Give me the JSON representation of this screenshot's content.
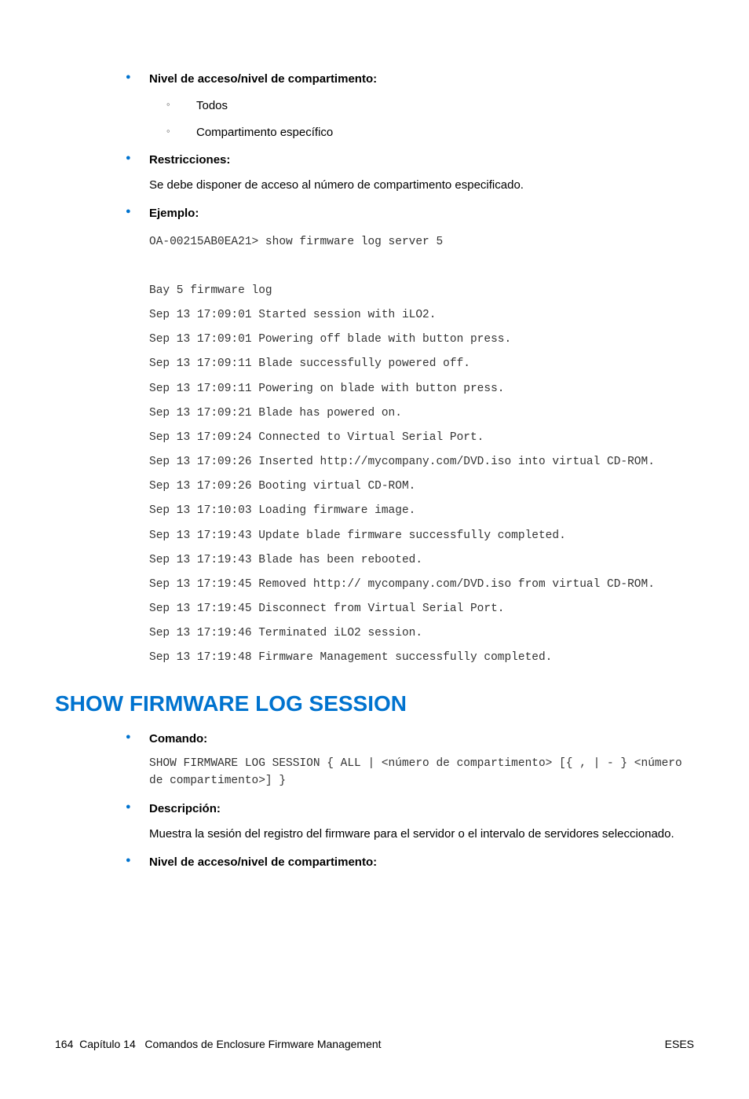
{
  "list1": {
    "item1": {
      "label": "Nivel de acceso/nivel de compartimento:",
      "sub": [
        "Todos",
        "Compartimento específico"
      ]
    },
    "item2": {
      "label": "Restricciones:",
      "body": "Se debe disponer de acceso al número de compartimento especificado."
    },
    "item3": {
      "label": "Ejemplo:",
      "code": "OA-00215AB0EA21> show firmware log server 5\n\nBay 5 firmware log\nSep 13 17:09:01 Started session with iLO2.\nSep 13 17:09:01 Powering off blade with button press.\nSep 13 17:09:11 Blade successfully powered off.\nSep 13 17:09:11 Powering on blade with button press.\nSep 13 17:09:21 Blade has powered on.\nSep 13 17:09:24 Connected to Virtual Serial Port.\nSep 13 17:09:26 Inserted http://mycompany.com/DVD.iso into virtual CD-ROM.\nSep 13 17:09:26 Booting virtual CD-ROM.\nSep 13 17:10:03 Loading firmware image.\nSep 13 17:19:43 Update blade firmware successfully completed.\nSep 13 17:19:43 Blade has been rebooted.\nSep 13 17:19:45 Removed http:// mycompany.com/DVD.iso from virtual CD-ROM.\nSep 13 17:19:45 Disconnect from Virtual Serial Port.\nSep 13 17:19:46 Terminated iLO2 session.\nSep 13 17:19:48 Firmware Management successfully completed."
    }
  },
  "heading2": "SHOW FIRMWARE LOG SESSION",
  "list2": {
    "item1": {
      "label": "Comando:",
      "code": "SHOW FIRMWARE LOG SESSION { ALL | <número de compartimento> [{ , | - } <número de compartimento>] }"
    },
    "item2": {
      "label": "Descripción:",
      "body": "Muestra la sesión del registro del firmware para el servidor o el intervalo de servidores seleccionado."
    },
    "item3": {
      "label": "Nivel de acceso/nivel de compartimento:"
    }
  },
  "footer": {
    "page": "164",
    "chapter_label": "Capítulo 14",
    "chapter_title": "Comandos de Enclosure Firmware Management",
    "right": "ESES"
  }
}
